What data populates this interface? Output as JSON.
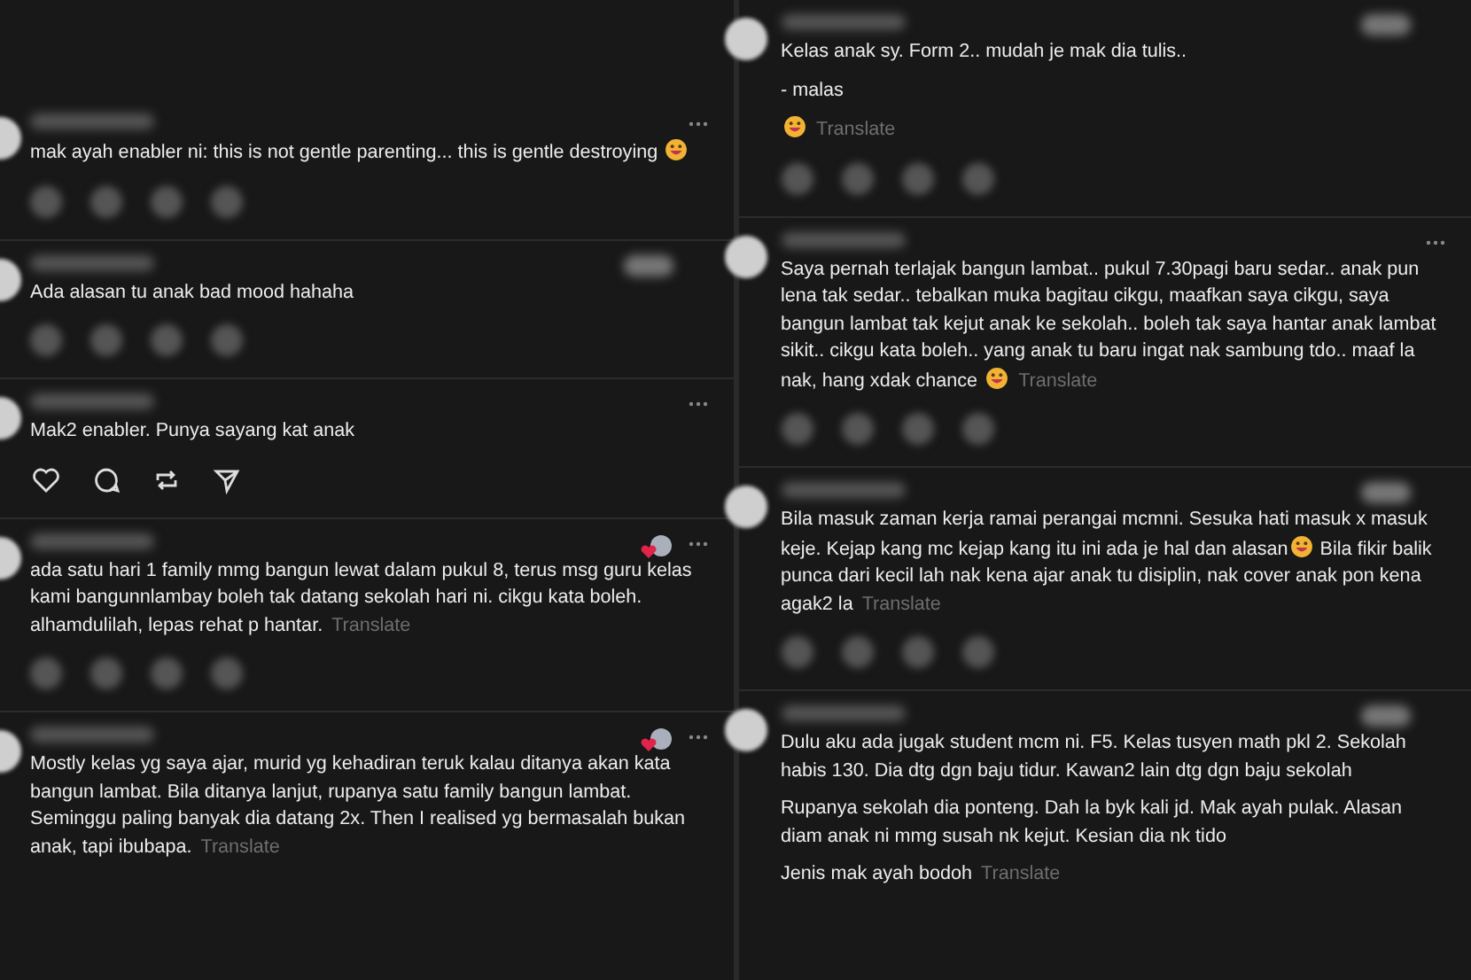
{
  "columns": [
    {
      "comments": [
        {
          "menu": true,
          "liked_badge": false,
          "blurred_badge": false,
          "action_icons": false,
          "blurred_actions": true,
          "paragraphs": [
            [
              {
                "kind": "text",
                "text": "mak ayah enabler ni: this is not gentle parenting... this is gentle destroying "
              },
              {
                "kind": "emoji"
              }
            ]
          ]
        },
        {
          "menu": false,
          "liked_badge": false,
          "blurred_badge": true,
          "action_icons": false,
          "blurred_actions": true,
          "paragraphs": [
            [
              {
                "kind": "text",
                "text": "Ada alasan tu anak bad mood hahaha"
              }
            ]
          ]
        },
        {
          "menu": true,
          "liked_badge": false,
          "blurred_badge": false,
          "action_icons": true,
          "blurred_actions": false,
          "paragraphs": [
            [
              {
                "kind": "text",
                "text": "Mak2 enabler. Punya sayang kat anak"
              }
            ]
          ]
        },
        {
          "menu": true,
          "liked_badge": true,
          "blurred_badge": false,
          "action_icons": false,
          "blurred_actions": true,
          "translate": "Translate",
          "paragraphs": [
            [
              {
                "kind": "text",
                "text": "ada satu hari 1 family mmg bangun lewat dalam pukul 8, terus msg guru kelas kami bangunnlambay boleh tak datang sekolah hari ni. cikgu kata boleh. alhamdulilah, lepas rehat p hantar."
              }
            ]
          ]
        },
        {
          "menu": true,
          "liked_badge": true,
          "blurred_badge": false,
          "action_icons": false,
          "blurred_actions": false,
          "translate": "Translate",
          "paragraphs": [
            [
              {
                "kind": "text",
                "text": "Mostly kelas yg saya ajar, murid yg kehadiran teruk kalau ditanya akan kata bangun lambat. Bila ditanya lanjut, rupanya satu family bangun lambat. Seminggu paling banyak dia datang 2x. Then I realised yg bermasalah bukan anak, tapi ibubapa."
              }
            ]
          ]
        }
      ]
    },
    {
      "comments": [
        {
          "menu": false,
          "liked_badge": false,
          "blurred_badge": true,
          "action_icons": false,
          "blurred_actions": true,
          "translate": "Translate",
          "paragraphs": [
            [
              {
                "kind": "text",
                "text": "Kelas anak sy. Form 2.. mudah je mak dia tulis.."
              }
            ],
            [
              {
                "kind": "text",
                "text": "- malas"
              }
            ],
            [
              {
                "kind": "emoji"
              }
            ]
          ]
        },
        {
          "menu": true,
          "liked_badge": false,
          "blurred_badge": false,
          "action_icons": false,
          "blurred_actions": true,
          "translate": "Translate",
          "paragraphs": [
            [
              {
                "kind": "text",
                "text": "Saya pernah terlajak bangun lambat.. pukul 7.30pagi baru sedar.. anak pun lena tak sedar.. tebalkan muka bagitau cikgu, maafkan saya cikgu, saya bangun lambat tak kejut anak ke sekolah.. boleh tak saya hantar anak lambat sikit.. cikgu kata boleh.. yang anak tu baru ingat nak sambung tdo.. maaf la nak, hang xdak chance "
              },
              {
                "kind": "emoji"
              }
            ]
          ]
        },
        {
          "menu": false,
          "liked_badge": false,
          "blurred_badge": true,
          "action_icons": false,
          "blurred_actions": true,
          "translate": "Translate",
          "paragraphs": [
            [
              {
                "kind": "text",
                "text": "Bila masuk zaman kerja ramai perangai mcmni. Sesuka hati masuk x masuk keje. Kejap kang mc kejap kang itu ini ada je hal dan alasan"
              },
              {
                "kind": "emoji"
              },
              {
                "kind": "text",
                "text": " Bila fikir balik punca dari kecil lah nak kena ajar anak tu disiplin, nak cover anak pon kena agak2 la"
              }
            ]
          ]
        },
        {
          "menu": false,
          "liked_badge": false,
          "blurred_badge": true,
          "action_icons": false,
          "blurred_actions": false,
          "translate": "Translate",
          "paragraphs": [
            [
              {
                "kind": "text",
                "text": "Dulu aku ada jugak student mcm ni. F5. Kelas tusyen math pkl 2. Sekolah habis 130. Dia dtg dgn baju tidur. Kawan2 lain dtg dgn baju sekolah"
              }
            ],
            [
              {
                "kind": "text",
                "text": "Rupanya sekolah dia ponteng. Dah la byk kali jd. Mak ayah pulak. Alasan diam anak ni mmg susah nk kejut. Kesian dia nk tido"
              }
            ],
            [
              {
                "kind": "text",
                "text": "Jenis mak ayah bodoh"
              }
            ]
          ]
        }
      ]
    }
  ]
}
